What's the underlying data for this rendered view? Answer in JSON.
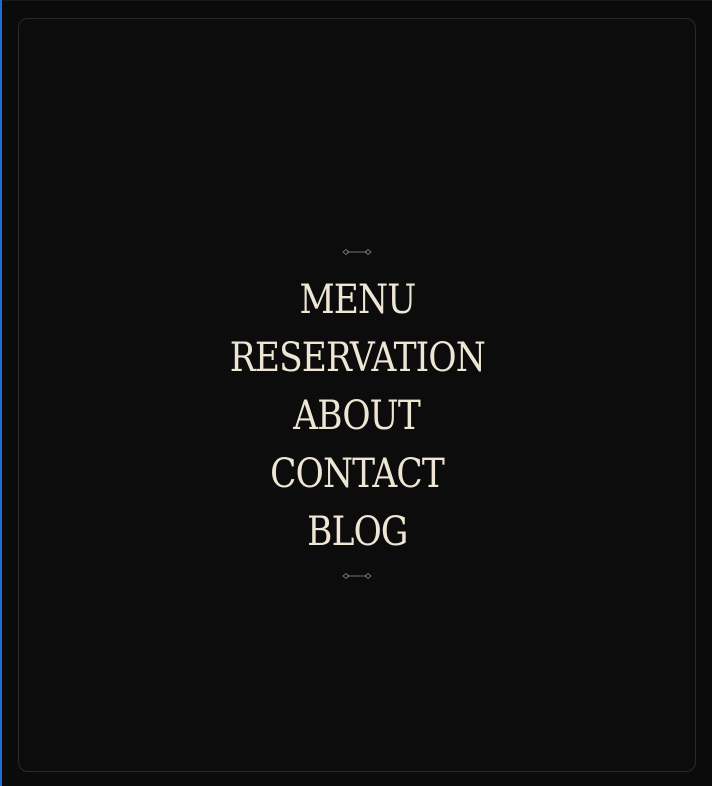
{
  "nav": {
    "items": [
      {
        "label": "MENU"
      },
      {
        "label": "RESERVATION"
      },
      {
        "label": "ABOUT"
      },
      {
        "label": "CONTACT"
      },
      {
        "label": "BLOG"
      }
    ]
  },
  "colors": {
    "background": "#0c0c0c",
    "text": "#ede6d4",
    "ornament": "#6f6f6f",
    "left_accent": "#1f6fd1",
    "panel_border": "#2a2a2a"
  },
  "icons": {
    "top_ornament": "divider-ornament-icon",
    "bottom_ornament": "divider-ornament-icon"
  }
}
